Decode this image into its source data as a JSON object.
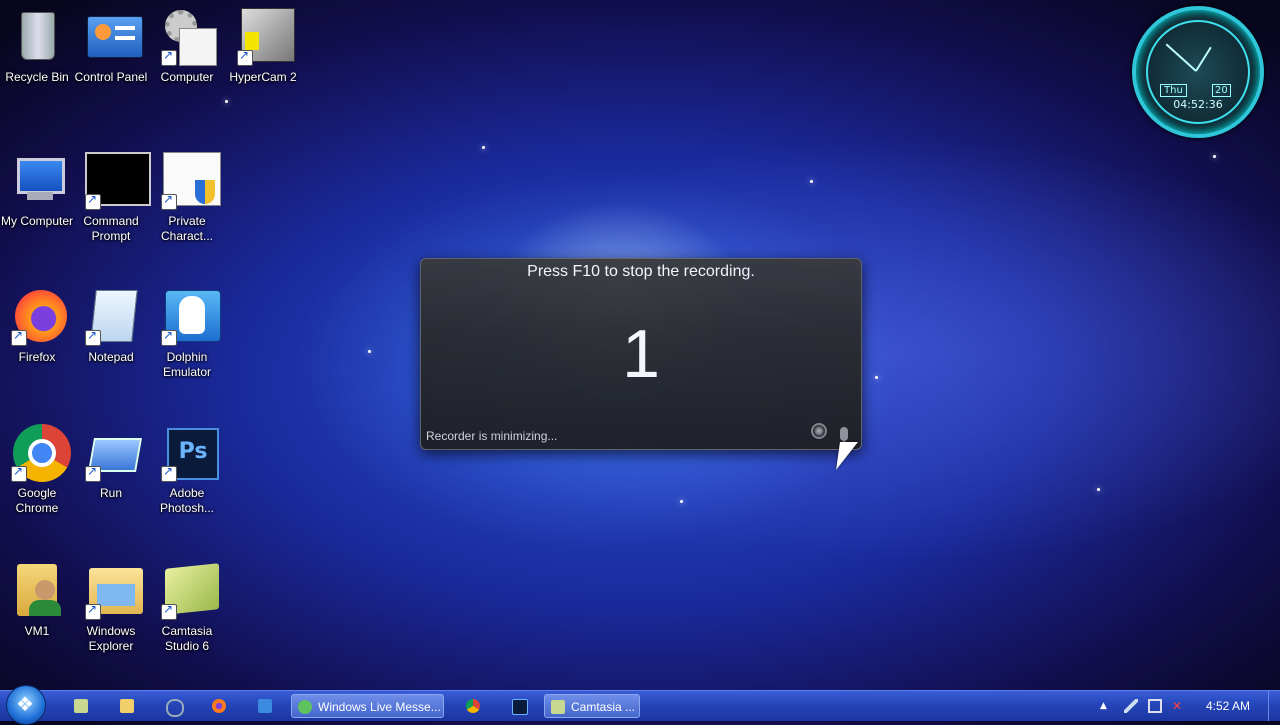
{
  "desktop": {
    "icons": [
      {
        "label": "Recycle Bin",
        "icon": "recycle-bin-icon"
      },
      {
        "label": "Control Panel",
        "icon": "control-panel-icon"
      },
      {
        "label": "Computer",
        "icon": "computer-icon"
      },
      {
        "label": "HyperCam 2",
        "icon": "hypercam-icon"
      },
      {
        "label": "My Computer",
        "icon": "monitor-icon"
      },
      {
        "label": "Command Prompt",
        "icon": "command-prompt-icon"
      },
      {
        "label": "Private Charact...",
        "icon": "private-character-icon"
      },
      {
        "label": "Firefox",
        "icon": "firefox-icon"
      },
      {
        "label": "Notepad",
        "icon": "notepad-icon"
      },
      {
        "label": "Dolphin Emulator",
        "icon": "dolphin-icon"
      },
      {
        "label": "Google Chrome",
        "icon": "chrome-icon"
      },
      {
        "label": "Run",
        "icon": "run-icon"
      },
      {
        "label": "Adobe Photosh...",
        "icon": "photoshop-icon"
      },
      {
        "label": "VM1",
        "icon": "user-folder-icon"
      },
      {
        "label": "Windows Explorer",
        "icon": "folder-icon"
      },
      {
        "label": "Camtasia Studio 6",
        "icon": "camtasia-icon"
      }
    ]
  },
  "clock_gadget": {
    "day": "Thu",
    "date": "20",
    "time": "04:52:36"
  },
  "recorder": {
    "instruction": "Press F10 to stop the recording.",
    "countdown": "1",
    "status": "Recorder is minimizing..."
  },
  "taskbar": {
    "tasks": [
      {
        "label": "Windows Live Messe...",
        "icon": "messenger-icon"
      },
      {
        "label": "Camtasia ...",
        "icon": "camtasia-icon"
      }
    ],
    "clock": "4:52 AM"
  }
}
